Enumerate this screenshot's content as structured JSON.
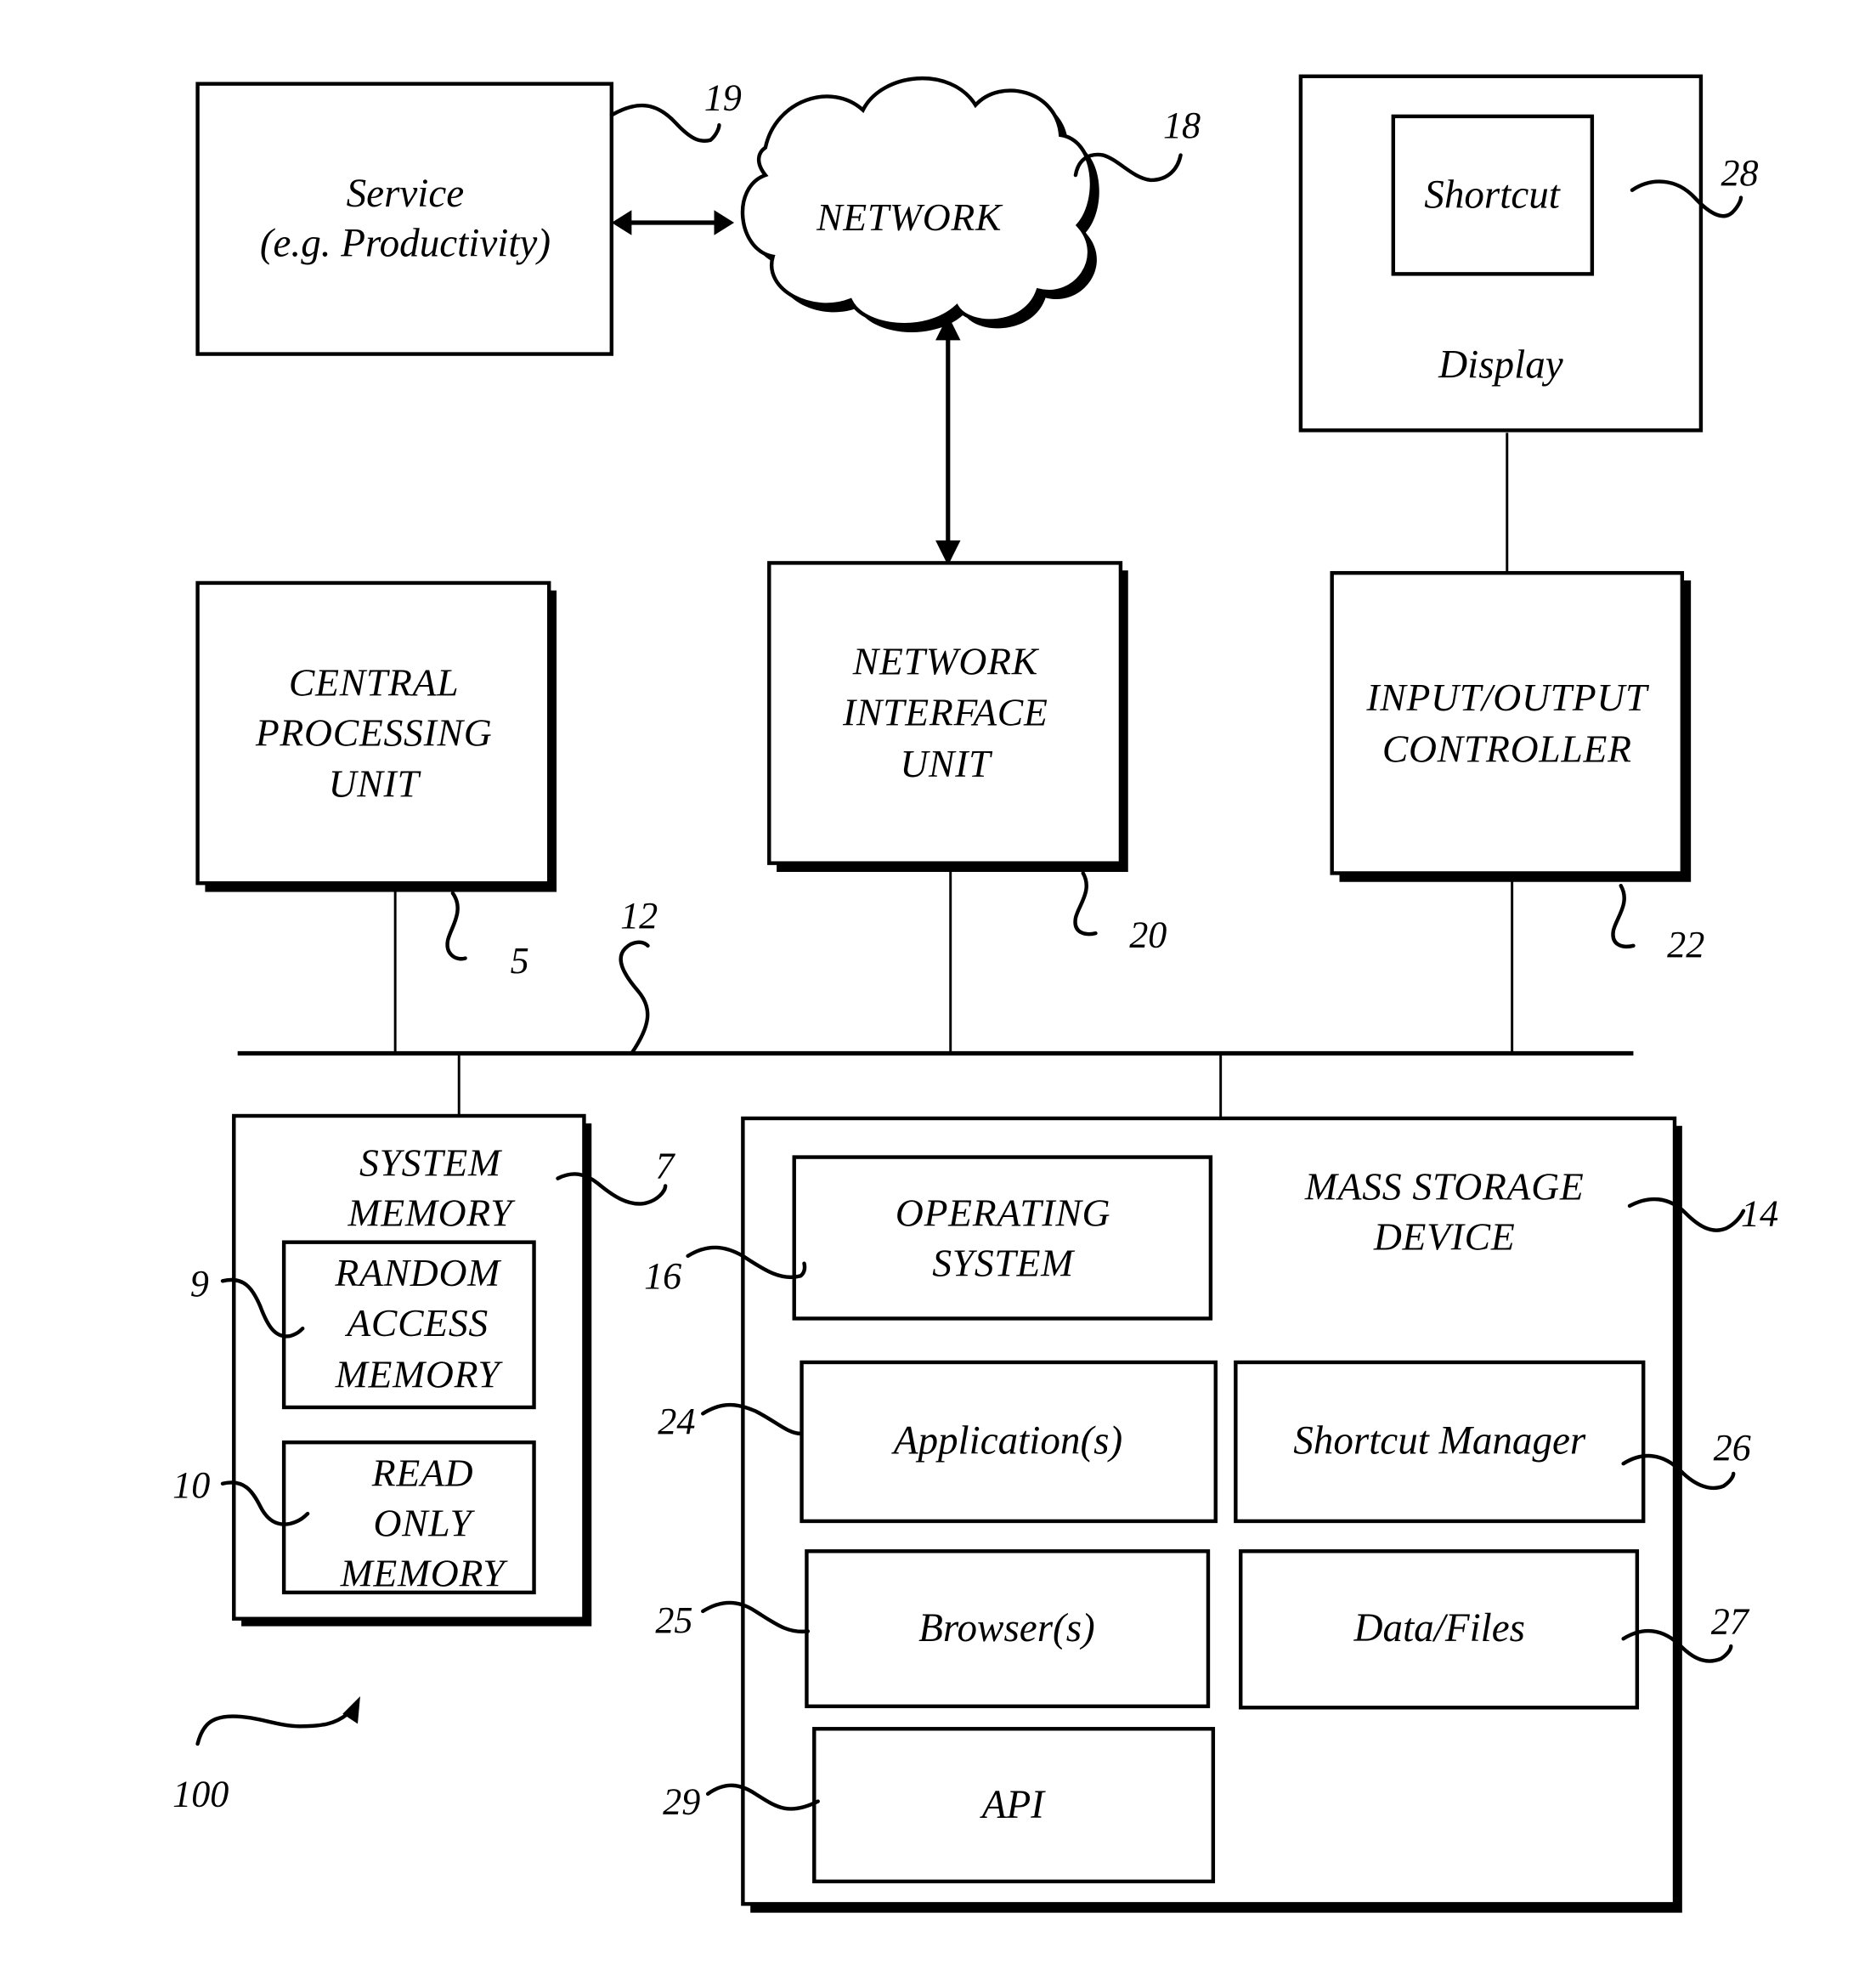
{
  "figure": {
    "service": {
      "lines": [
        "Service",
        "(e.g. Productivity)"
      ],
      "ref": "19"
    },
    "network": {
      "label": "NETWORK",
      "ref": "18"
    },
    "display": {
      "label": "Display",
      "ref": "28",
      "shortcut_label": "Shortcut"
    },
    "cpu": {
      "lines": [
        "CENTRAL",
        "PROCESSING",
        "UNIT"
      ],
      "ref": "5"
    },
    "network_interface_unit": {
      "lines": [
        "NETWORK",
        "INTERFACE",
        "UNIT"
      ],
      "ref": "20"
    },
    "io_controller": {
      "lines": [
        "INPUT/OUTPUT",
        "CONTROLLER"
      ],
      "ref": "22"
    },
    "system_bus": {
      "ref": "12"
    },
    "system_memory": {
      "lines": [
        "SYSTEM",
        "MEMORY"
      ],
      "ref": "7",
      "ram": {
        "lines": [
          "RANDOM",
          "ACCESS",
          "MEMORY"
        ],
        "ref": "9"
      },
      "rom": {
        "lines": [
          "READ",
          "ONLY",
          "MEMORY"
        ],
        "ref": "10"
      }
    },
    "mass_storage": {
      "lines": [
        "MASS STORAGE",
        "DEVICE"
      ],
      "ref": "14",
      "operating_system": {
        "lines": [
          "OPERATING",
          "SYSTEM"
        ],
        "ref": "16"
      },
      "applications": {
        "label": "Application(s)",
        "ref": "24"
      },
      "shortcut_manager": {
        "label": "Shortcut Manager",
        "ref": "26"
      },
      "browsers": {
        "label": "Browser(s)",
        "ref": "25"
      },
      "data_files": {
        "label": "Data/Files",
        "ref": "27"
      },
      "api": {
        "label": "API",
        "ref": "29"
      }
    },
    "system_ref": "100"
  }
}
